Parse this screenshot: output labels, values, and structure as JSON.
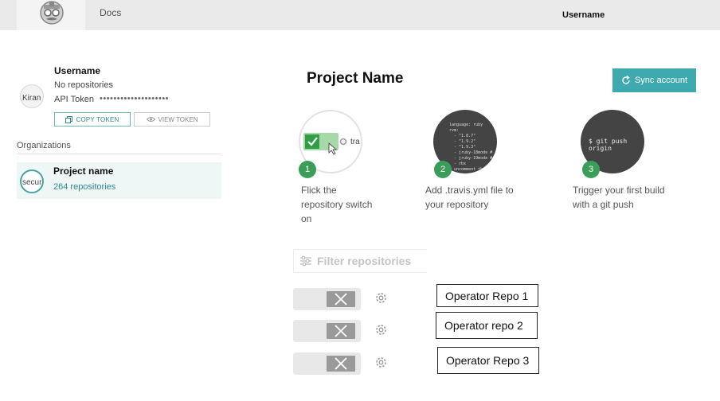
{
  "nav": {
    "logo_icon": "travis-mascot-icon",
    "docs_label": "Docs",
    "username": "Username"
  },
  "profile": {
    "avatar_alt": "Kiran",
    "name": "Username",
    "repo_status": "No repositories",
    "api_token_label": "API Token",
    "api_token_masked": "••••••••••••••••••••",
    "copy_token_label": "COPY TOKEN",
    "view_token_label": "VIEW TOKEN"
  },
  "organizations": {
    "heading": "Organizations",
    "items": [
      {
        "avatar_alt": "secur",
        "name": "Project name",
        "count": "264 repositories"
      }
    ]
  },
  "main": {
    "project_title": "Project Name",
    "sync_label": "Sync account",
    "steps": [
      {
        "number": "1",
        "text": "Flick the repository switch on",
        "snippet": "tra"
      },
      {
        "number": "2",
        "text": "Add .travis.yml file to your repository"
      },
      {
        "number": "3",
        "text": "Trigger your first build with a git push",
        "snippet": "$ git push origin"
      }
    ],
    "filter_placeholder": "Filter repositories",
    "repos": [
      {
        "name": "Operator Repo 1"
      },
      {
        "name": "Operator repo 2"
      },
      {
        "name": "Operator Repo 3"
      }
    ]
  },
  "colors": {
    "accent": "#3eaaaf",
    "step_badge": "#3a9e5a",
    "toggle_on": "#3cb371"
  }
}
